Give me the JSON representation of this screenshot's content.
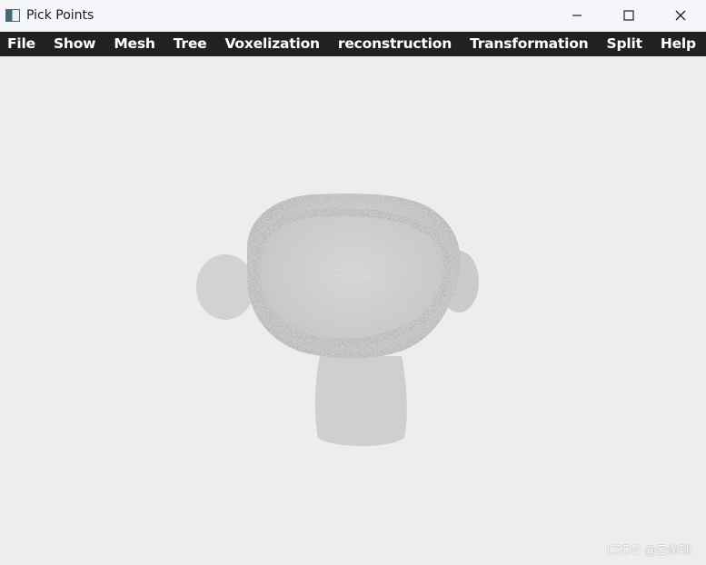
{
  "window": {
    "title": "Pick Points"
  },
  "menu": {
    "items": [
      "File",
      "Show",
      "Mesh",
      "Tree",
      "Voxelization",
      "reconstruction",
      "Transformation",
      "Split",
      "Help"
    ]
  },
  "viewport": {
    "watermark": "CSDN @云杂项",
    "point_color": "#bdbdbd",
    "background": "#ededed"
  }
}
